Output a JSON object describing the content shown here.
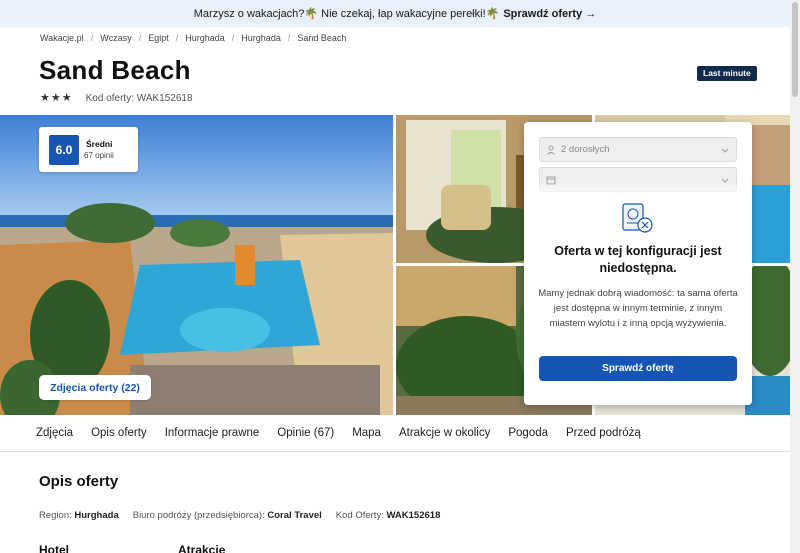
{
  "promo": {
    "text": "Marzysz o wakacjach?🌴 Nie czekaj, łap wakacyjne perełki!🌴",
    "link": "Sprawdź oferty →"
  },
  "breadcrumb": [
    "Wakacje.pl",
    "Wczasy",
    "Egipt",
    "Hurghada",
    "Hurghada",
    "Sand Beach"
  ],
  "hotel": {
    "name": "Sand Beach",
    "badge": "Last minute",
    "stars": 3,
    "offer_code_label": "Kod oferty: WAK152618"
  },
  "score": {
    "value": "6.0",
    "label": "Średni",
    "count": "67 opinii"
  },
  "gallery": {
    "button": "Zdjęcia oferty (22)"
  },
  "booking": {
    "persons": "2 dorosłych",
    "date": "",
    "title": "Oferta w tej konfiguracji jest niedostępna.",
    "text": "Mamy jednak dobrą wiadomość: ta sama oferta jest dostępna w innym terminie, z innym miastem wylotu i z inną opcją wyżywienia.",
    "button": "Sprawdź ofertę"
  },
  "tabs": [
    "Zdjęcia",
    "Opis oferty",
    "Informacje prawne",
    "Opinie (67)",
    "Mapa",
    "Atrakcje w okolicy",
    "Pogoda",
    "Przed podróżą"
  ],
  "description": {
    "title": "Opis oferty",
    "region_label": "Region:",
    "region_value": "Hurghada",
    "agency_label": "Biuro podróży (przedsiębiorca):",
    "agency_value": "Coral Travel",
    "code_label": "Kod Oferty:",
    "code_value": "WAK152618",
    "sub_hotel": "Hotel",
    "sub_attractions": "Atrakcje"
  },
  "colors": {
    "brand_blue": "#1556b5",
    "badge_navy": "#0f2a4d",
    "promo_bg": "#e8f1fb"
  }
}
